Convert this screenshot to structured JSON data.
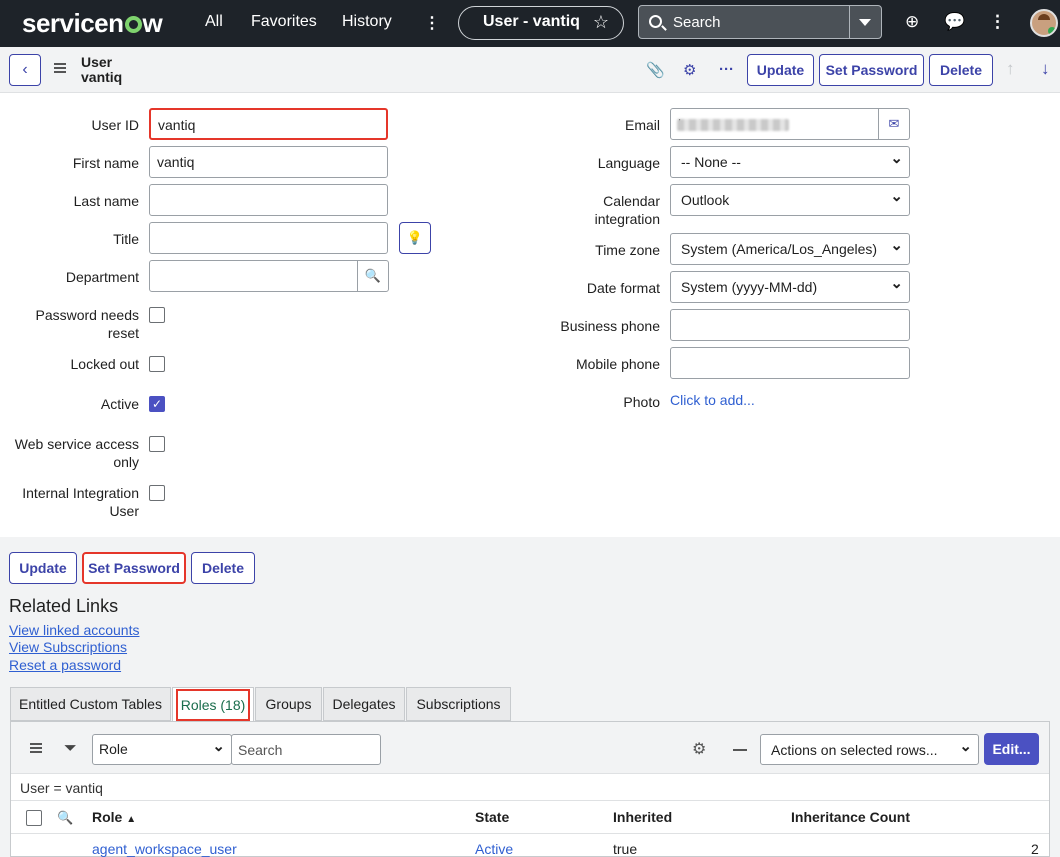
{
  "topbar": {
    "logo_text": "servicenow",
    "nav": [
      "All",
      "Favorites",
      "History"
    ],
    "record_pill": "User - vantiq",
    "search_label": "Search"
  },
  "header": {
    "record_type": "User",
    "record_name": "vantiq",
    "update_label": "Update",
    "set_password_label": "Set Password",
    "delete_label": "Delete"
  },
  "form_left": {
    "user_id_label": "User ID",
    "user_id_value": "vantiq",
    "first_name_label": "First name",
    "first_name_value": "vantiq",
    "last_name_label": "Last name",
    "last_name_value": "",
    "title_label": "Title",
    "title_value": "",
    "department_label": "Department",
    "department_value": "",
    "password_needs_reset_label": "Password needs reset",
    "locked_out_label": "Locked out",
    "active_label": "Active",
    "web_service_label": "Web service access only",
    "internal_integration_label": "Internal Integration User"
  },
  "form_right": {
    "email_label": "Email",
    "email_value": "l",
    "language_label": "Language",
    "language_value": "-- None --",
    "calendar_label": "Calendar integration",
    "calendar_value": "Outlook",
    "timezone_label": "Time zone",
    "timezone_value": "System (America/Los_Angeles)",
    "dateformat_label": "Date format",
    "dateformat_value": "System (yyyy-MM-dd)",
    "business_phone_label": "Business phone",
    "business_phone_value": "",
    "mobile_phone_label": "Mobile phone",
    "mobile_phone_value": "",
    "photo_label": "Photo",
    "photo_link": "Click to add..."
  },
  "checkboxes": {
    "password_needs_reset": false,
    "locked_out": false,
    "active": true,
    "web_service_access_only": false,
    "internal_integration_user": false
  },
  "bottom_buttons": {
    "update": "Update",
    "set_password": "Set Password",
    "delete": "Delete"
  },
  "related_links": {
    "title": "Related Links",
    "links": [
      "View linked accounts",
      "View Subscriptions",
      "Reset a password"
    ]
  },
  "tabs": [
    "Entitled Custom Tables",
    "Roles (18)",
    "Groups",
    "Delegates",
    "Subscriptions"
  ],
  "list": {
    "field_select": "Role",
    "search_placeholder": "Search",
    "actions_select": "Actions on selected rows...",
    "edit_label": "Edit...",
    "filter_text": "User = vantiq",
    "columns": [
      "Role",
      "State",
      "Inherited",
      "Inheritance Count"
    ],
    "rows": [
      {
        "role": "agent_workspace_user",
        "state": "Active",
        "inherited": "true",
        "count": "2"
      }
    ]
  },
  "colors": {
    "topbar_bg": "#1e2329",
    "accent": "#3c43a8",
    "highlight": "#e5362a",
    "link": "#2f5fd1"
  }
}
